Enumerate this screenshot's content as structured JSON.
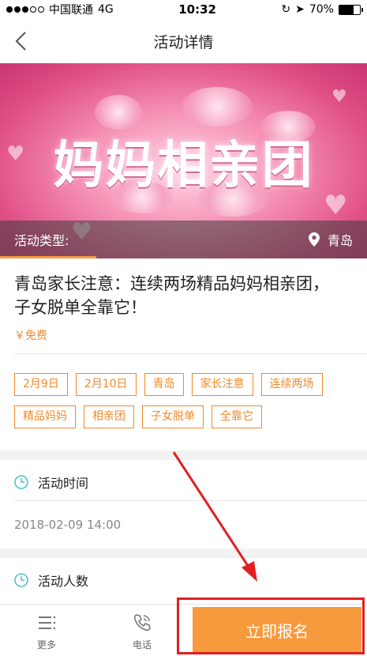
{
  "status_bar": {
    "carrier": "中国联通",
    "network": "4G",
    "time": "10:32",
    "battery": "70%",
    "battery_level": 0.7
  },
  "nav": {
    "title": "活动详情"
  },
  "banner": {
    "title": "妈妈相亲团",
    "type_label": "活动类型:",
    "location": "青岛"
  },
  "event": {
    "headline": "青岛家长注意：连续两场精品妈妈相亲团，子女脱单全靠它！",
    "price": "￥免费",
    "tags": [
      "2月9日",
      "2月10日",
      "青岛",
      "家长注意",
      "连续两场",
      "精品妈妈",
      "相亲团",
      "子女脱单",
      "全靠它"
    ]
  },
  "sections": {
    "time_label": "活动时间",
    "time_value": "2018-02-09 14:00",
    "people_label": "活动人数"
  },
  "bottom_bar": {
    "more_label": "更多",
    "phone_label": "电话",
    "signup_label": "立即报名"
  },
  "colors": {
    "accent": "#f79a3e",
    "tag_orange": "#f08a2a",
    "icon_teal": "#4fc3c9",
    "annotation_red": "#e02020"
  }
}
